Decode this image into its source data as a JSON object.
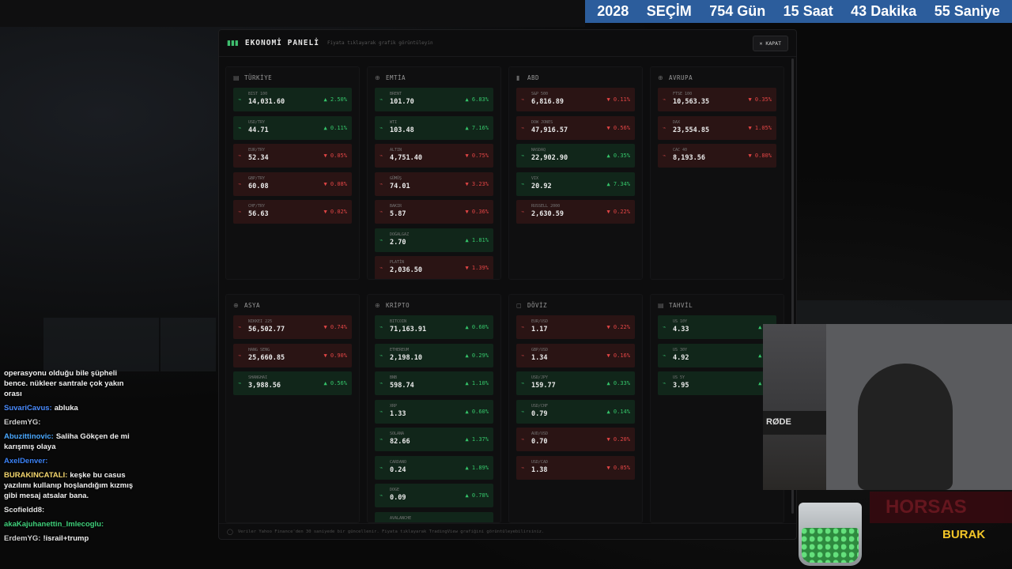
{
  "countdown": {
    "year": "2028",
    "label": "SEÇİM",
    "days": "754 Gün",
    "hours": "15 Saat",
    "minutes": "43 Dakika",
    "seconds": "55 Saniye"
  },
  "panel": {
    "title": "EKONOMİ PANELİ",
    "subtitle": "Fiyata tıklayarak grafik görüntüleyin",
    "close_label": "KAPAT",
    "footer": "Veriler Yahoo Finance'den 30 saniyede bir güncellenir. Fiyata tıklayarak TradingView grafiğini görüntüleyebilirsiniz."
  },
  "sections": [
    {
      "title": "TÜRKİYE",
      "icon": "building-icon",
      "items": [
        {
          "name": "BIST 100",
          "value": "14,031.60",
          "change": "▲ 2.50%",
          "dir": "up"
        },
        {
          "name": "USD/TRY",
          "value": "44.71",
          "change": "▲ 0.11%",
          "dir": "up"
        },
        {
          "name": "EUR/TRY",
          "value": "52.34",
          "change": "▼ 0.05%",
          "dir": "down"
        },
        {
          "name": "GBP/TRY",
          "value": "60.08",
          "change": "▼ 0.08%",
          "dir": "down"
        },
        {
          "name": "CHF/TRY",
          "value": "56.63",
          "change": "▼ 0.02%",
          "dir": "down"
        }
      ]
    },
    {
      "title": "EMTİA",
      "icon": "globe-icon",
      "items": [
        {
          "name": "BRENT",
          "value": "101.70",
          "change": "▲ 6.83%",
          "dir": "up"
        },
        {
          "name": "WTI",
          "value": "103.48",
          "change": "▲ 7.16%",
          "dir": "up"
        },
        {
          "name": "ALTIN",
          "value": "4,751.40",
          "change": "▼ 0.75%",
          "dir": "down"
        },
        {
          "name": "GÜMÜŞ",
          "value": "74.01",
          "change": "▼ 3.23%",
          "dir": "down"
        },
        {
          "name": "BAKIR",
          "value": "5.87",
          "change": "▼ 0.36%",
          "dir": "down"
        },
        {
          "name": "DOĞALGAZ",
          "value": "2.70",
          "change": "▲ 1.81%",
          "dir": "up"
        },
        {
          "name": "PLATİN",
          "value": "2,036.50",
          "change": "▼ 1.39%",
          "dir": "down"
        }
      ]
    },
    {
      "title": "ABD",
      "icon": "bar-chart-icon",
      "items": [
        {
          "name": "S&P 500",
          "value": "6,816.89",
          "change": "▼ 0.11%",
          "dir": "down"
        },
        {
          "name": "DOW JONES",
          "value": "47,916.57",
          "change": "▼ 0.56%",
          "dir": "down"
        },
        {
          "name": "NASDAQ",
          "value": "22,902.90",
          "change": "▲ 0.35%",
          "dir": "up"
        },
        {
          "name": "VIX",
          "value": "20.92",
          "change": "▲ 7.34%",
          "dir": "up"
        },
        {
          "name": "RUSSELL 2000",
          "value": "2,630.59",
          "change": "▼ 0.22%",
          "dir": "down"
        }
      ]
    },
    {
      "title": "AVRUPA",
      "icon": "globe-icon",
      "items": [
        {
          "name": "FTSE 100",
          "value": "10,563.35",
          "change": "▼ 0.35%",
          "dir": "down"
        },
        {
          "name": "DAX",
          "value": "23,554.85",
          "change": "▼ 1.05%",
          "dir": "down"
        },
        {
          "name": "CAC 40",
          "value": "8,193.56",
          "change": "▼ 0.80%",
          "dir": "down"
        }
      ]
    },
    {
      "title": "ASYA",
      "icon": "globe-icon",
      "items": [
        {
          "name": "NIKKEI 225",
          "value": "56,502.77",
          "change": "▼ 0.74%",
          "dir": "down"
        },
        {
          "name": "HANG SENG",
          "value": "25,660.85",
          "change": "▼ 0.90%",
          "dir": "down"
        },
        {
          "name": "SHANGHAI",
          "value": "3,988.56",
          "change": "▲ 0.56%",
          "dir": "up"
        }
      ]
    },
    {
      "title": "KRİPTO",
      "icon": "lightning-icon",
      "items": [
        {
          "name": "BITCOIN",
          "value": "71,163.91",
          "change": "▲ 0.60%",
          "dir": "up"
        },
        {
          "name": "ETHEREUM",
          "value": "2,198.10",
          "change": "▲ 0.29%",
          "dir": "up"
        },
        {
          "name": "BNB",
          "value": "598.74",
          "change": "▲ 1.10%",
          "dir": "up"
        },
        {
          "name": "XRP",
          "value": "1.33",
          "change": "▲ 0.60%",
          "dir": "up"
        },
        {
          "name": "SOLANA",
          "value": "82.66",
          "change": "▲ 1.37%",
          "dir": "up"
        },
        {
          "name": "CARDANO",
          "value": "0.24",
          "change": "▲ 1.89%",
          "dir": "up"
        },
        {
          "name": "DOGE",
          "value": "0.09",
          "change": "▲ 0.78%",
          "dir": "up"
        },
        {
          "name": "AVALANCHE",
          "value": "",
          "change": "",
          "dir": "up"
        }
      ]
    },
    {
      "title": "DÖVİZ",
      "icon": "square-icon",
      "items": [
        {
          "name": "EUR/USD",
          "value": "1.17",
          "change": "▼ 0.22%",
          "dir": "down"
        },
        {
          "name": "GBP/USD",
          "value": "1.34",
          "change": "▼ 0.16%",
          "dir": "down"
        },
        {
          "name": "USD/JPY",
          "value": "159.77",
          "change": "▲ 0.33%",
          "dir": "up"
        },
        {
          "name": "USD/CHF",
          "value": "0.79",
          "change": "▲ 0.14%",
          "dir": "up"
        },
        {
          "name": "AUD/USD",
          "value": "0.70",
          "change": "▼ 0.20%",
          "dir": "down"
        },
        {
          "name": "USD/CAD",
          "value": "1.38",
          "change": "▼ 0.05%",
          "dir": "down"
        }
      ]
    },
    {
      "title": "TAHVİL",
      "icon": "document-icon",
      "items": [
        {
          "name": "US 10Y",
          "value": "4.33",
          "change": "▲ 0.",
          "dir": "up"
        },
        {
          "name": "US 30Y",
          "value": "4.92",
          "change": "▲ 0.",
          "dir": "up"
        },
        {
          "name": "US 5Y",
          "value": "3.95",
          "change": "▲ 0.",
          "dir": "up"
        }
      ]
    }
  ],
  "chat": [
    {
      "user": "",
      "text": "operasyonu olduğu bile şüpheli bence. nükleer santrale çok yakın orası",
      "color": "#f0f0f0"
    },
    {
      "user": "SuvariCavus:",
      "text": "abluka",
      "color": "#4a8cff"
    },
    {
      "user": "ErdemYG:",
      "text": "",
      "color": "#cfcfcf"
    },
    {
      "user": "Abuzittinovic:",
      "text": "Saliha Gökçen de mi karışmış olaya",
      "color": "#4aa8ff"
    },
    {
      "user": "AxelDenver:",
      "text": "",
      "color": "#3b82f6"
    },
    {
      "user": "BURAKINCATALI:",
      "text": "keşke bu casus yazılımı kullanıp hoşlandığım kızmış gibi mesaj atsalar bana.",
      "color": "#f5d76e"
    },
    {
      "user": "Scofieldd8:",
      "text": "",
      "color": "#e0e0e0"
    },
    {
      "user": "akaKajuhanettin_Imlecoglu:",
      "text": "",
      "color": "#3fcf7a"
    },
    {
      "user": "ErdemYG:",
      "text": "!israil+trump",
      "color": "#cfcfcf"
    }
  ],
  "overlay": {
    "mic_brand": "RØDE",
    "streamer": "BURAK",
    "banner_text": "HORSAS"
  }
}
